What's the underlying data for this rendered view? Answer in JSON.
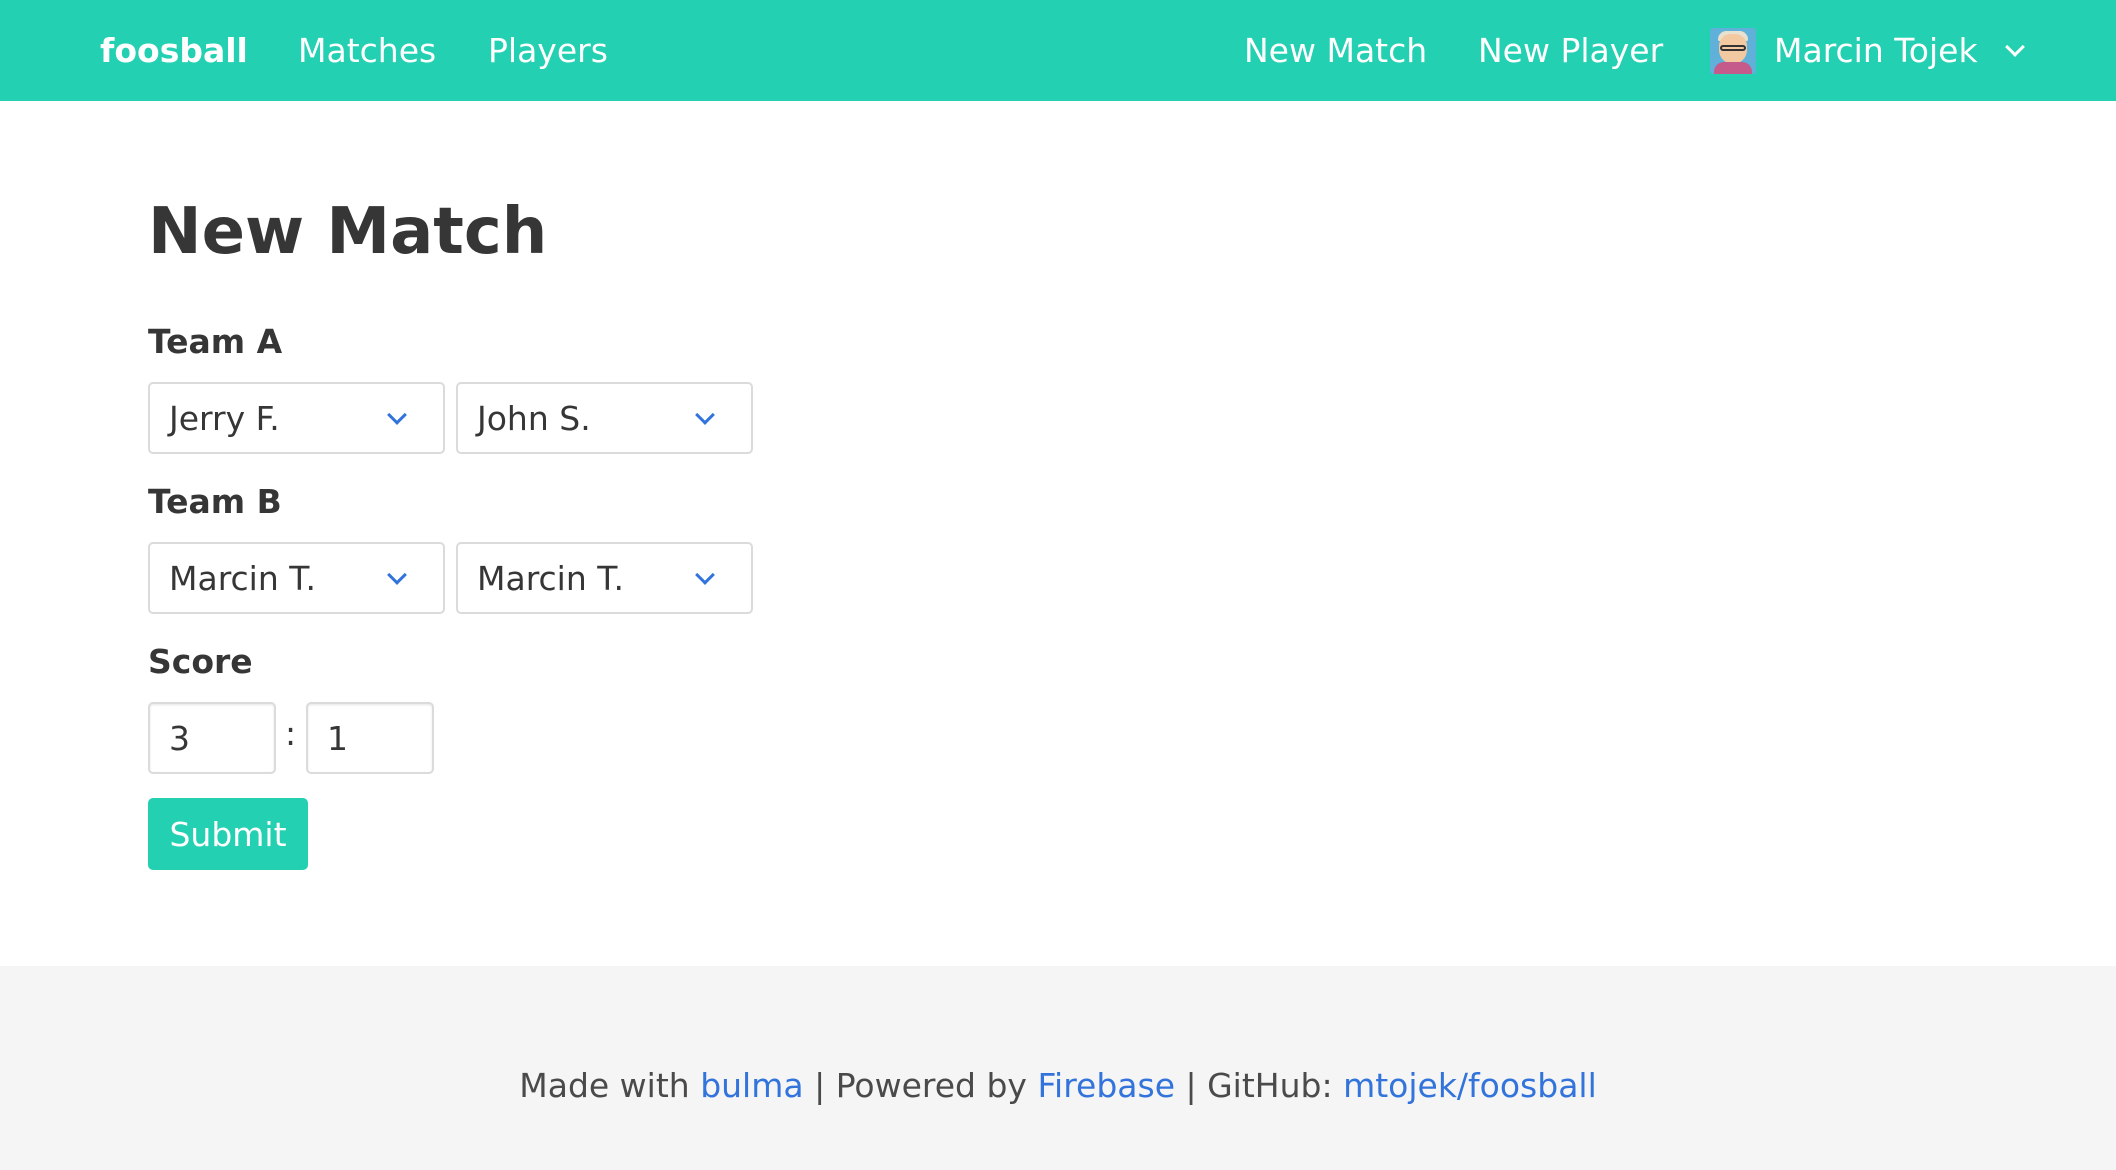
{
  "navbar": {
    "brand": "foosball",
    "links": [
      "Matches",
      "Players"
    ],
    "right_links": [
      "New Match",
      "New Player"
    ],
    "user": {
      "name": "Marcin Tojek",
      "avatar_icon": "user-avatar"
    },
    "background_color": "#23d0b2"
  },
  "form": {
    "title": "New Match",
    "team_a": {
      "label": "Team A",
      "player1": "Jerry F.",
      "player2": "John S."
    },
    "team_b": {
      "label": "Team B",
      "player1": "Marcin T.",
      "player2": "Marcin T."
    },
    "score": {
      "label": "Score",
      "team_a": "3",
      "separator": ":",
      "team_b": "1"
    },
    "submit_label": "Submit"
  },
  "footer": {
    "made_with": "Made with ",
    "bulma_link": "bulma",
    "powered_by": " | Powered by ",
    "firebase_link": "Firebase",
    "github_prefix": " | GitHub: ",
    "github_link": "mtojek/foosball",
    "link_color": "#3273dc"
  }
}
